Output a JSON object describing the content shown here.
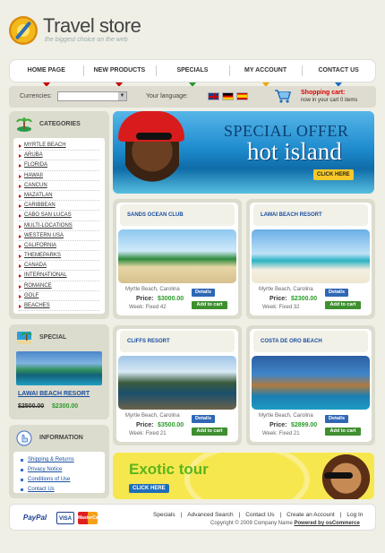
{
  "header": {
    "title": "Travel store",
    "tagline": "the biggest choice on the web"
  },
  "nav": [
    "HOME PAGE",
    "NEW PRODUCTS",
    "SPECIALS",
    "MY ACCOUNT",
    "CONTACT US"
  ],
  "nav_marker_colors": [
    "#cc0000",
    "#cc0000",
    "#2a9a2a",
    "#f0a800",
    "#1a6fc4"
  ],
  "toolbar": {
    "currencies_label": "Currencies:",
    "currency_value": "",
    "language_label": "Your language:",
    "languages": [
      "English",
      "Deutsch",
      "Español"
    ],
    "cart_title": "Shopping cart:",
    "cart_status": "now in your cart 0 items"
  },
  "categories": {
    "title": "CATEGORIES",
    "items": [
      "MYRTLE BEACH",
      "ARUBA",
      "FLORIDA",
      "HAWAII",
      "CANCUN",
      "MAZATLAN",
      "CARIBBEAN",
      "CABO SAN LUCAS",
      "MULTI-LOCATIONS",
      "WESTERN USA",
      "CALIFORNIA",
      "THEMEPARKS",
      "CANADA",
      "INTERNATIONAL",
      "ROMANCE",
      "GOLF",
      "BEACHES"
    ]
  },
  "special": {
    "title": "SPECIAL",
    "name": "LAWAI BEACH RESORT",
    "old_price": "$2500.00",
    "new_price": "$2300.00"
  },
  "information": {
    "title": "INFORMATION",
    "items": [
      "Shipping & Returns",
      "Privacy Notice",
      "Conditions of Use",
      "Contact Us"
    ]
  },
  "banner_top": {
    "line1": "SPECIAL OFFER",
    "line2": "hot island",
    "button": "CLICK HERE"
  },
  "banner_bottom": {
    "title": "Exotic tour",
    "button": "CLICK HERE"
  },
  "products": [
    {
      "name": "SANDS OCEAN CLUB",
      "location": "Myrtle Beach, Carolina",
      "price_label": "Price:",
      "price": "$3000.00",
      "week": "Week: Fixed 42",
      "details": "Details",
      "add": "Add to cart"
    },
    {
      "name": "LAWAI BEACH RESORT",
      "location": "Myrtle Beach, Carolina",
      "price_label": "Price:",
      "price": "$2300.00",
      "week": "Week: Fixed 32",
      "details": "Details",
      "add": "Add to cart"
    },
    {
      "name": "CLIFFS RESORT",
      "location": "Myrtle Beach, Carolina",
      "price_label": "Price:",
      "price": "$3500.00",
      "week": "Week: Fixed 21",
      "details": "Details",
      "add": "Add to cart"
    },
    {
      "name": "COSTA DE ORO BEACH",
      "location": "Myrtle Beach, Carolina",
      "price_label": "Price:",
      "price": "$2899.00",
      "week": "Week: Fixed 21",
      "details": "Details",
      "add": "Add to cart"
    }
  ],
  "footer": {
    "payments": [
      "PayPal",
      "VISA",
      "MasterCard"
    ],
    "links": [
      "Specials",
      "Advanced Search",
      "Contact Us",
      "Create an Account",
      "Log In"
    ],
    "copyright": "Copyright © 2009 Company Name",
    "powered": "Powered by osCommerce"
  }
}
